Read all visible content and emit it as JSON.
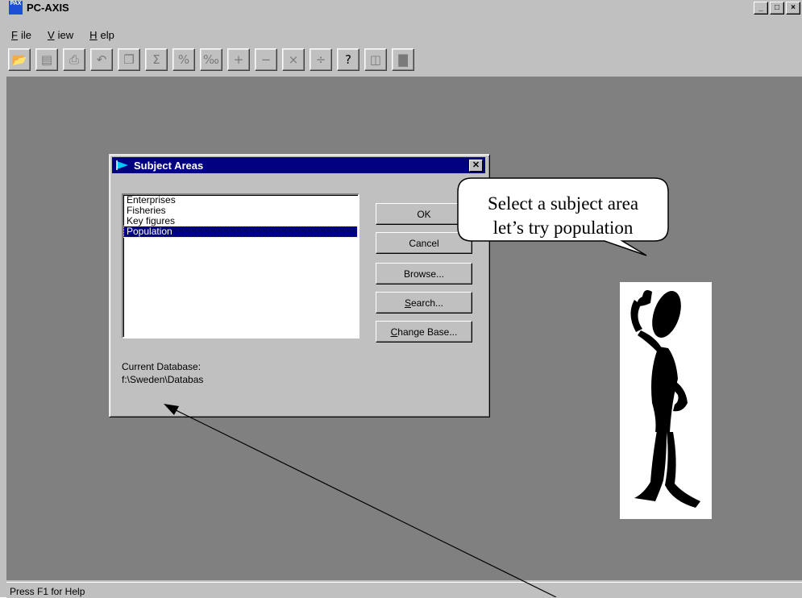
{
  "app": {
    "title": "PC-AXIS",
    "icon_text": "PAX",
    "icon": "pc-axis-app-icon"
  },
  "window_controls": {
    "minimize": "_",
    "maximize": "□",
    "close": "×"
  },
  "menu": {
    "items": [
      {
        "label": "File",
        "accel": "F"
      },
      {
        "label": "View",
        "accel": "V"
      },
      {
        "label": "Help",
        "accel": "H"
      }
    ]
  },
  "toolbar": {
    "buttons": [
      {
        "name": "open-icon",
        "glyph": "📂",
        "enabled": true
      },
      {
        "name": "save-icon",
        "glyph": "▤",
        "enabled": false
      },
      {
        "name": "print-icon",
        "glyph": "⎙",
        "enabled": false
      },
      {
        "name": "undo-icon",
        "glyph": "↶",
        "enabled": false
      },
      {
        "name": "copy-icon",
        "glyph": "❐",
        "enabled": false
      },
      {
        "name": "sum-icon",
        "glyph": "Σ",
        "enabled": false
      },
      {
        "name": "percent-icon",
        "glyph": "%",
        "enabled": false
      },
      {
        "name": "per-mille-icon",
        "glyph": "‰",
        "enabled": false
      },
      {
        "name": "add-icon",
        "glyph": "+",
        "enabled": false
      },
      {
        "name": "subtract-icon",
        "glyph": "−",
        "enabled": false
      },
      {
        "name": "multiply-icon",
        "glyph": "×",
        "enabled": false
      },
      {
        "name": "divide-icon",
        "glyph": "÷",
        "enabled": false
      },
      {
        "name": "help-icon",
        "glyph": "?",
        "enabled": true
      },
      {
        "name": "columns-icon",
        "glyph": "◫",
        "enabled": false
      },
      {
        "name": "chart-icon",
        "glyph": "▇",
        "enabled": false
      }
    ]
  },
  "dialog": {
    "title": "Subject Areas",
    "items": [
      {
        "label": "Enterprises",
        "selected": false
      },
      {
        "label": "Fisheries",
        "selected": false
      },
      {
        "label": "Key figures",
        "selected": false
      },
      {
        "label": "Population",
        "selected": true
      }
    ],
    "buttons": {
      "ok": "OK",
      "cancel": "Cancel",
      "browse": "Browse...",
      "search": {
        "accel": "S",
        "rest": "earch..."
      },
      "change_base": {
        "accel": "C",
        "rest": "hange Base..."
      }
    },
    "db_label": "Current Database:",
    "db_value": "f:\\Sweden\\Databas"
  },
  "callout": {
    "line1": "Select a subject area",
    "line2": "let’s try population"
  },
  "status": {
    "text": "Press F1 for Help"
  },
  "colors": {
    "desktop": "#808080",
    "chrome": "#c0c0c0",
    "title_active": "#000080",
    "selection": "#000080"
  }
}
